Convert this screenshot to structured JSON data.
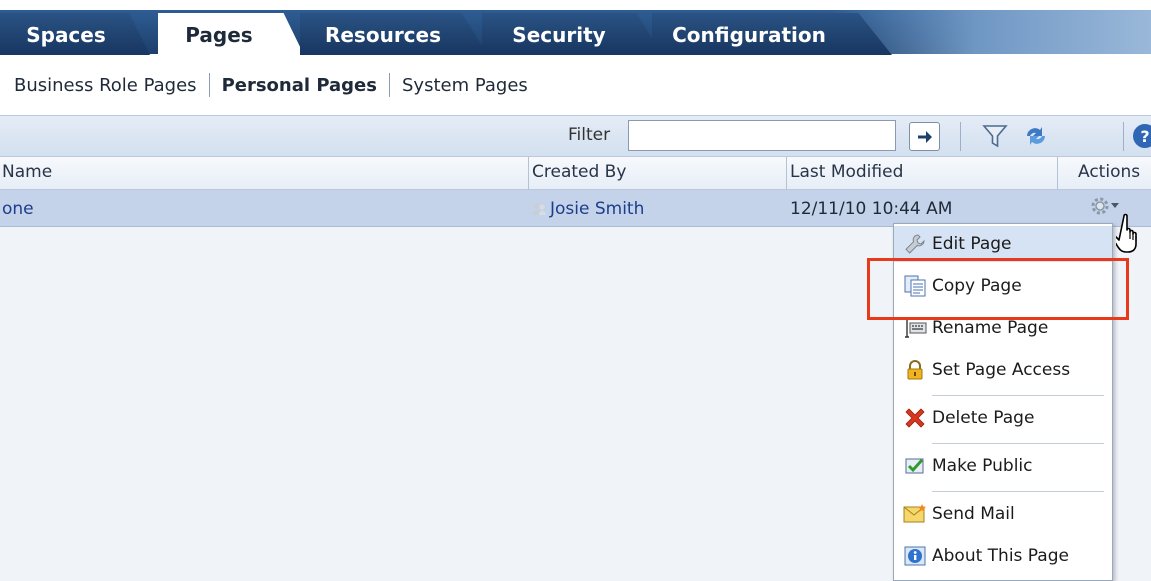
{
  "tabs": [
    {
      "label": "Spaces"
    },
    {
      "label": "Pages"
    },
    {
      "label": "Resources"
    },
    {
      "label": "Security"
    },
    {
      "label": "Configuration"
    }
  ],
  "active_tab": "Pages",
  "subnav": {
    "items": [
      {
        "label": "Business Role Pages"
      },
      {
        "label": "Personal Pages"
      },
      {
        "label": "System Pages"
      }
    ],
    "current": "Personal Pages"
  },
  "toolbar": {
    "filter_label": "Filter",
    "filter_value": "",
    "icons": [
      "go-arrow-icon",
      "filter-funnel-icon",
      "refresh-icon",
      "help-icon"
    ]
  },
  "table": {
    "columns": [
      {
        "label": "Name"
      },
      {
        "label": "Created By"
      },
      {
        "label": "Last Modified"
      },
      {
        "label": "Actions"
      }
    ],
    "rows": [
      {
        "name": "one",
        "created_by": "Josie Smith",
        "last_modified": "12/11/10 10:44 AM",
        "actions_icon": "gear-icon"
      }
    ]
  },
  "actions_menu": {
    "items": [
      {
        "label": "Edit Page",
        "icon": "wrench-icon"
      },
      {
        "label": "Copy Page",
        "icon": "copy-pages-icon"
      },
      {
        "label": "Rename Page",
        "icon": "rename-keyboard-icon"
      },
      {
        "label": "Set Page Access",
        "icon": "padlock-icon"
      },
      {
        "label": "Delete Page",
        "icon": "red-x-icon"
      },
      {
        "label": "Make Public",
        "icon": "green-check-icon"
      },
      {
        "label": "Send Mail",
        "icon": "envelope-icon"
      },
      {
        "label": "About This Page",
        "icon": "info-icon"
      }
    ],
    "highlighted": "Copy Page"
  },
  "colors": {
    "tab_band": "#1d3f6b",
    "row_selected": "#c5d3ea",
    "link": "#1c3e8a",
    "highlight_box": "#e8391b"
  }
}
